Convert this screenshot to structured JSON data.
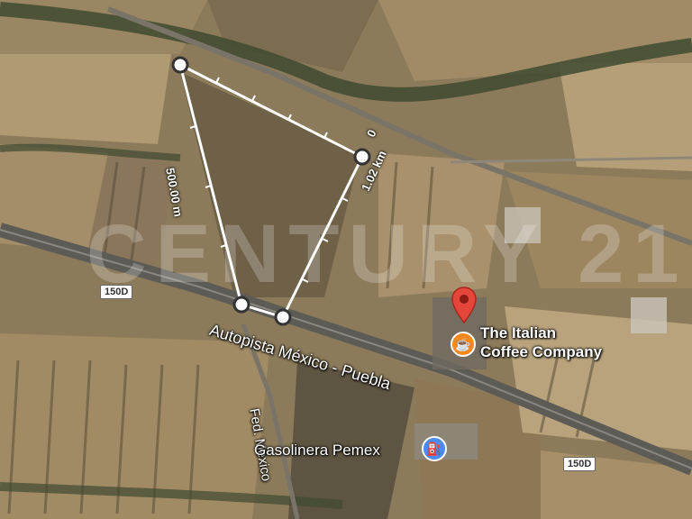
{
  "map": {
    "type": "satellite",
    "watermark": "CENTURY 21",
    "roads": {
      "highway_name": "Autopista México - Puebla",
      "federal_road": "Fed. México",
      "shield_1": "150D",
      "shield_2": "150D"
    },
    "places": {
      "gas_station": "Gasolinera Pemex",
      "poi_line1": "The Italian",
      "poi_line2": "Coffee Company"
    },
    "measurement": {
      "segment_1": "500.00 m",
      "segment_2": "1.02 km",
      "start": "0"
    },
    "colors": {
      "pin": "#e5463a",
      "coffee": "#f4881c",
      "gas": "#4a8af4",
      "measure_line": "#ffffff"
    }
  }
}
